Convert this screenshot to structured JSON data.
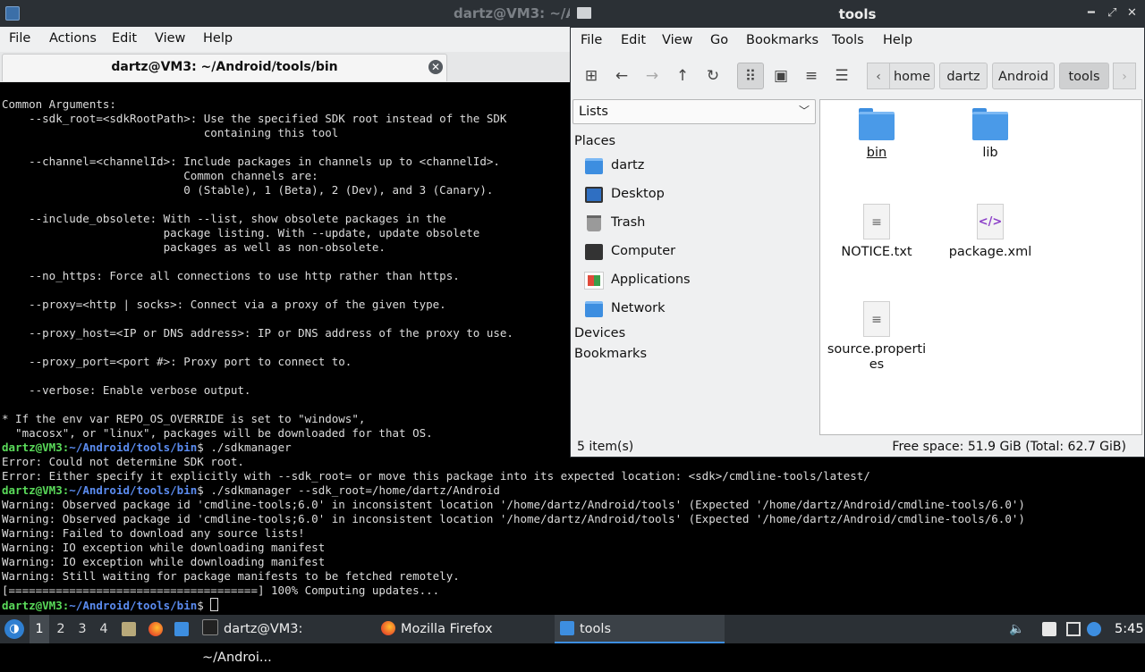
{
  "terminal": {
    "window_title": "dartz@VM3: ~/A",
    "menu": [
      "File",
      "Actions",
      "Edit",
      "View",
      "Help"
    ],
    "tab_title": "dartz@VM3: ~/Android/tools/bin",
    "lines": [
      {
        "text": "Common Arguments:"
      },
      {
        "text": "    --sdk_root=<sdkRootPath>: Use the specified SDK root instead of the SDK"
      },
      {
        "text": "                              containing this tool"
      },
      {
        "text": ""
      },
      {
        "text": "    --channel=<channelId>: Include packages in channels up to <channelId>."
      },
      {
        "text": "                           Common channels are:"
      },
      {
        "text": "                           0 (Stable), 1 (Beta), 2 (Dev), and 3 (Canary)."
      },
      {
        "text": ""
      },
      {
        "text": "    --include_obsolete: With --list, show obsolete packages in the"
      },
      {
        "text": "                        package listing. With --update, update obsolete"
      },
      {
        "text": "                        packages as well as non-obsolete."
      },
      {
        "text": ""
      },
      {
        "text": "    --no_https: Force all connections to use http rather than https."
      },
      {
        "text": ""
      },
      {
        "text": "    --proxy=<http | socks>: Connect via a proxy of the given type."
      },
      {
        "text": ""
      },
      {
        "text": "    --proxy_host=<IP or DNS address>: IP or DNS address of the proxy to use."
      },
      {
        "text": ""
      },
      {
        "text": "    --proxy_port=<port #>: Proxy port to connect to."
      },
      {
        "text": ""
      },
      {
        "text": "    --verbose: Enable verbose output."
      },
      {
        "text": ""
      },
      {
        "text": "* If the env var REPO_OS_OVERRIDE is set to \"windows\","
      },
      {
        "text": "  \"macosx\", or \"linux\", packages will be downloaded for that OS."
      },
      {
        "prompt_user": "dartz@VM3",
        "prompt_path": "~/Android/tools/bin",
        "text": "$ ./sdkmanager"
      },
      {
        "text": "Error: Could not determine SDK root."
      },
      {
        "text": "Error: Either specify it explicitly with --sdk_root= or move this package into its expected location: <sdk>/cmdline-tools/latest/"
      },
      {
        "prompt_user": "dartz@VM3",
        "prompt_path": "~/Android/tools/bin",
        "text": "$ ./sdkmanager --sdk_root=/home/dartz/Android"
      },
      {
        "text": "Warning: Observed package id 'cmdline-tools;6.0' in inconsistent location '/home/dartz/Android/tools' (Expected '/home/dartz/Android/cmdline-tools/6.0')"
      },
      {
        "text": "Warning: Observed package id 'cmdline-tools;6.0' in inconsistent location '/home/dartz/Android/tools' (Expected '/home/dartz/Android/cmdline-tools/6.0')"
      },
      {
        "text": "Warning: Failed to download any source lists!"
      },
      {
        "text": "Warning: IO exception while downloading manifest"
      },
      {
        "text": "Warning: IO exception while downloading manifest"
      },
      {
        "text": "Warning: Still waiting for package manifests to be fetched remotely."
      },
      {
        "text": "[=====================================] 100% Computing updates..."
      },
      {
        "prompt_user": "dartz@VM3",
        "prompt_path": "~/Android/tools/bin",
        "text": "$ ",
        "cursor": true
      }
    ]
  },
  "file_manager": {
    "window_title": "tools",
    "menu": [
      "File",
      "Edit",
      "View",
      "Go",
      "Bookmarks",
      "Tools",
      "Help"
    ],
    "breadcrumbs": [
      "home",
      "dartz",
      "Android",
      "tools"
    ],
    "sidebar": {
      "dropdown_value": "Lists",
      "places_heading": "Places",
      "places": [
        {
          "label": "dartz",
          "icon": "home-folder-icon"
        },
        {
          "label": "Desktop",
          "icon": "desktop-icon"
        },
        {
          "label": "Trash",
          "icon": "trash-icon"
        },
        {
          "label": "Computer",
          "icon": "computer-icon"
        },
        {
          "label": "Applications",
          "icon": "applications-icon"
        },
        {
          "label": "Network",
          "icon": "network-icon"
        }
      ],
      "devices_heading": "Devices",
      "bookmarks_heading": "Bookmarks"
    },
    "files": [
      {
        "name": "bin",
        "type": "folder"
      },
      {
        "name": "lib",
        "type": "folder"
      },
      {
        "name": "NOTICE.txt",
        "type": "text"
      },
      {
        "name": "package.xml",
        "type": "xml"
      },
      {
        "name": "source.properties",
        "type": "text"
      }
    ],
    "status_count": "5 item(s)",
    "status_free": "Free space: 51.9 GiB (Total: 62.7 GiB)"
  },
  "taskbar": {
    "workspaces": [
      "1",
      "2",
      "3",
      "4"
    ],
    "tasks": [
      {
        "label": "dartz@VM3: ~/Androi...",
        "icon": "terminal-icon"
      },
      {
        "label": "Mozilla Firefox",
        "icon": "firefox-icon"
      },
      {
        "label": "tools",
        "icon": "folder-icon"
      }
    ],
    "clock": "5:45"
  }
}
